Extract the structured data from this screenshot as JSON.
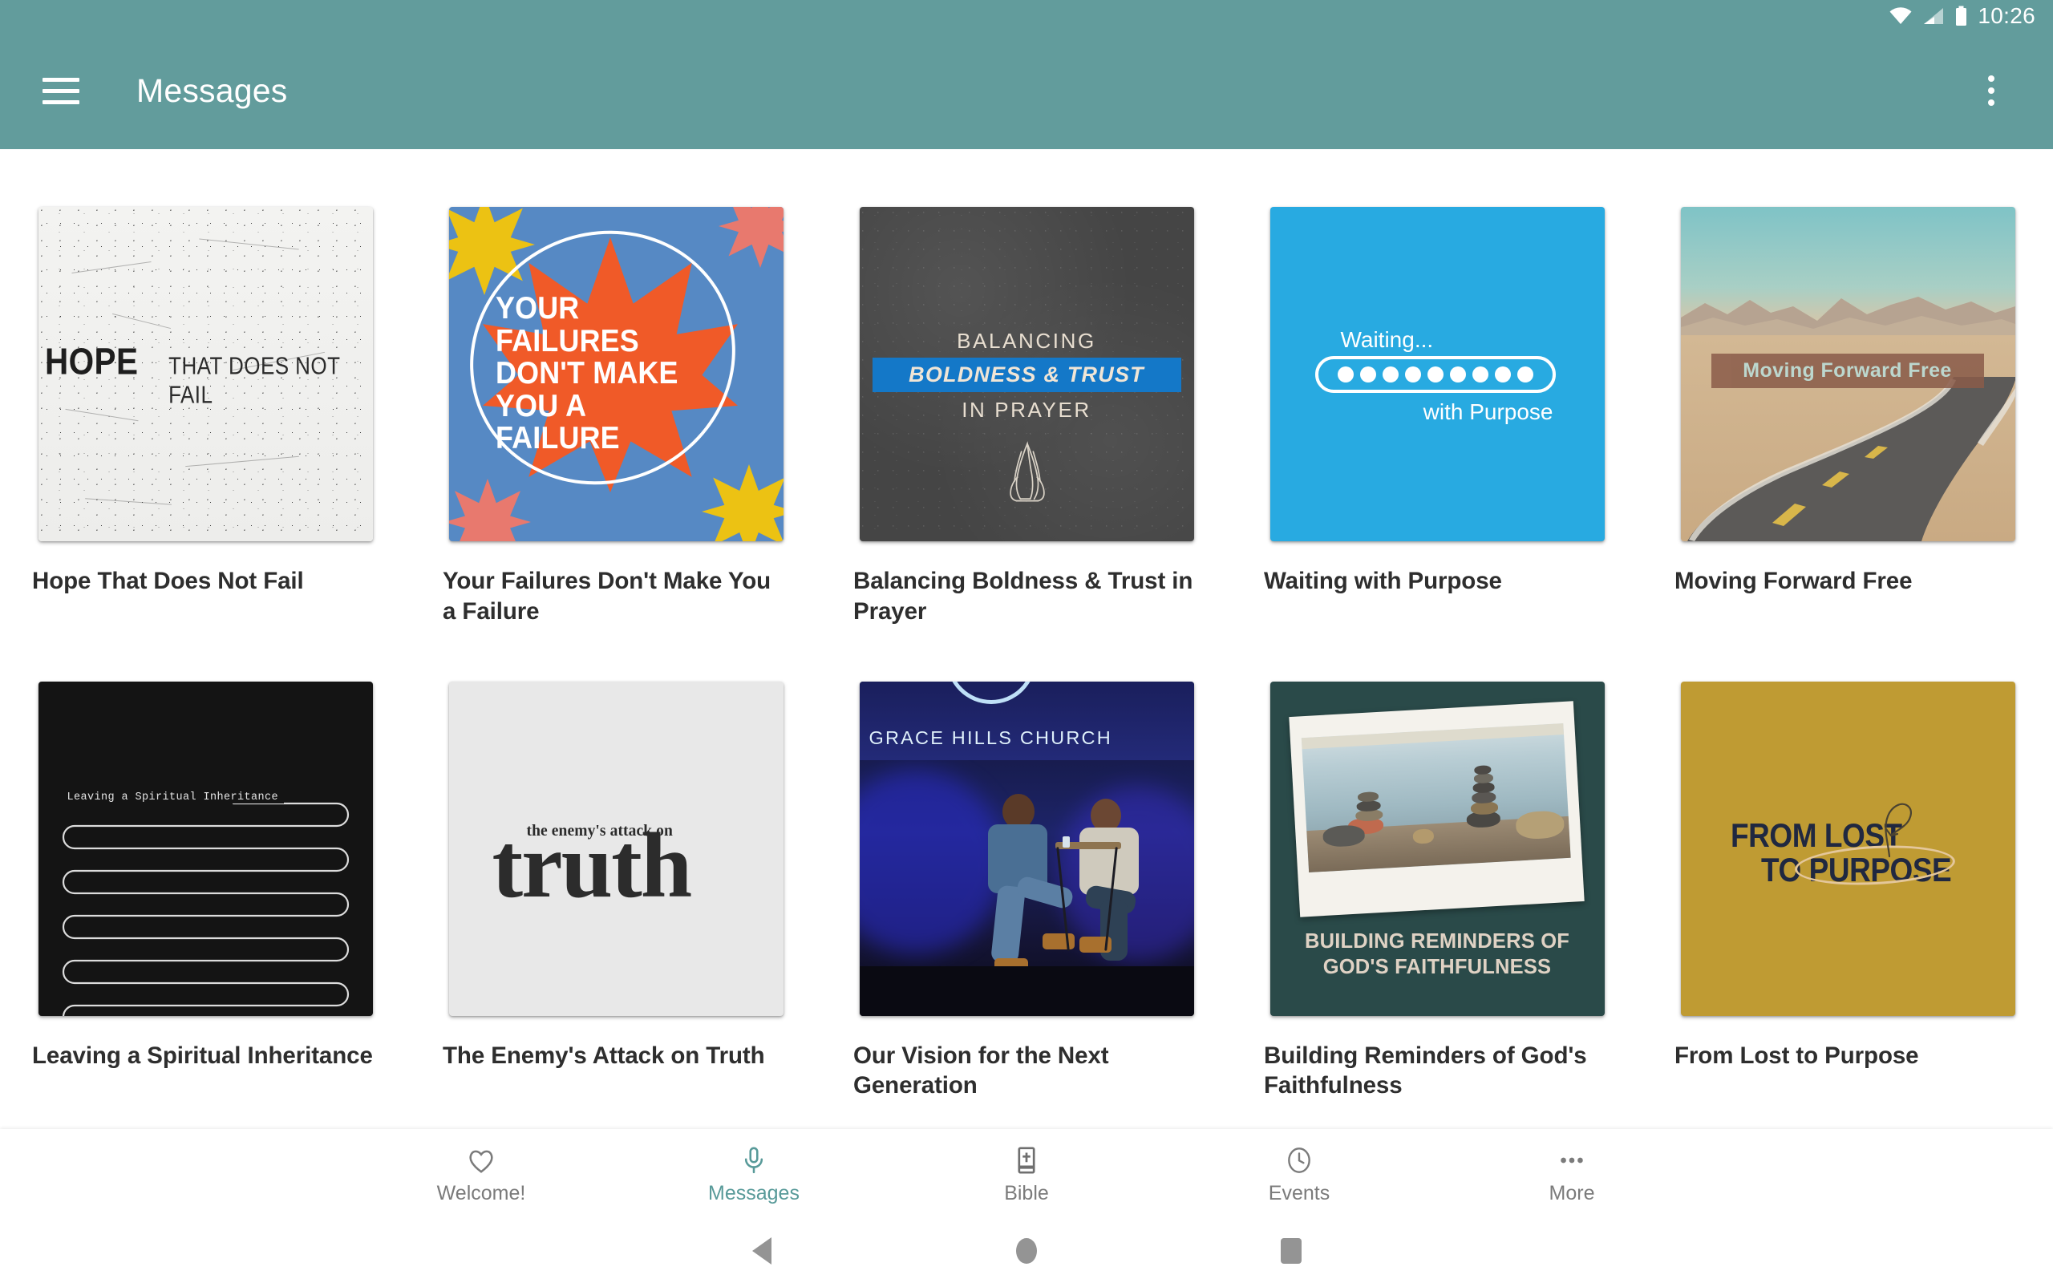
{
  "status_bar": {
    "time": "10:26",
    "icons": [
      "wifi-icon",
      "cellular-signal-icon",
      "battery-icon"
    ]
  },
  "app_bar": {
    "menu_icon": "hamburger-menu-icon",
    "title": "Messages",
    "overflow_icon": "overflow-menu-icon",
    "background_color": "#629c9c"
  },
  "messages": [
    {
      "title": "Hope That Does Not Fail",
      "artwork": {
        "style": "grunge-white-texture",
        "big_word": "HOPE",
        "small_words": "THAT DOES NOT FAIL"
      }
    },
    {
      "title": "Your Failures Don't Make You a Failure",
      "artwork": {
        "style": "blue-starburst",
        "lines": [
          "YOUR",
          "FAILURES",
          "DON'T MAKE",
          "YOU A",
          "FAILURE"
        ],
        "background_color": "#5689c4",
        "star_color": "#f05a28",
        "accent_colors": [
          "#ecc213",
          "#e8796e"
        ]
      }
    },
    {
      "title": "Balancing Boldness & Trust in Prayer",
      "artwork": {
        "style": "dark-textured",
        "line1": "BALANCING",
        "line2": "BOLDNESS & TRUST",
        "line3": "IN PRAYER",
        "highlight_color": "#1478c8",
        "icon": "praying-hands-icon"
      }
    },
    {
      "title": "Waiting with Purpose",
      "artwork": {
        "style": "blue-loading-pill",
        "line1": "Waiting...",
        "line2": "with Purpose",
        "dots": 9,
        "background_color": "#28aae1"
      }
    },
    {
      "title": "Moving Forward Free",
      "artwork": {
        "style": "desert-road-photo",
        "banner_text": "Moving Forward Free"
      }
    },
    {
      "title": "Leaving a Spiritual Inheritance",
      "artwork": {
        "style": "black-serpentine-line",
        "label": "Leaving a Spiritual Inheritance"
      }
    },
    {
      "title": "The Enemy's Attack on Truth",
      "artwork": {
        "style": "light-gray-slab-type",
        "small_text": "the enemy's attack on",
        "big_text": "truth"
      }
    },
    {
      "title": "Our Vision for the Next Generation",
      "artwork": {
        "style": "stage-photo",
        "banner_text": "GRACE HILLS CHURCH"
      }
    },
    {
      "title": "Building Reminders of God's Faithfulness",
      "artwork": {
        "style": "teal-polaroid-stones",
        "caption_line1": "BUILDING REMINDERS OF",
        "caption_line2": "GOD'S FAITHFULNESS",
        "background_color": "#2a4a49"
      }
    },
    {
      "title": "From Lost to Purpose",
      "artwork": {
        "style": "gold-type",
        "line1": "FROM LOST",
        "line2": "TO PURPOSE",
        "background_color": "#bf9b33"
      }
    }
  ],
  "bottom_nav": {
    "active_color": "#589a99",
    "items": [
      {
        "label": "Welcome!",
        "icon": "heart-icon",
        "active": false
      },
      {
        "label": "Messages",
        "icon": "microphone-icon",
        "active": true
      },
      {
        "label": "Bible",
        "icon": "bible-book-icon",
        "active": false
      },
      {
        "label": "Events",
        "icon": "clock-icon",
        "active": false
      },
      {
        "label": "More",
        "icon": "more-dots-icon",
        "active": false
      }
    ]
  },
  "system_nav": {
    "back": "back-triangle-icon",
    "home": "home-circle-icon",
    "recents": "recents-square-icon"
  }
}
